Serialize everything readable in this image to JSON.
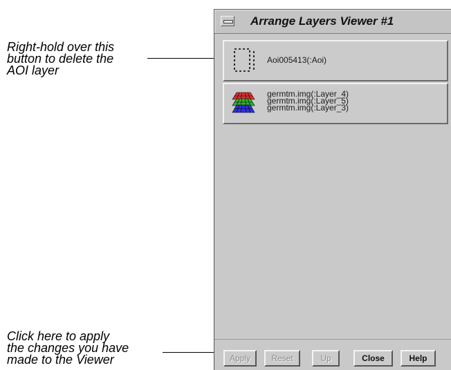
{
  "annotations": {
    "top": [
      "Right-hold over this",
      "button to delete the",
      "AOI layer"
    ],
    "bottom": [
      "Click here to apply",
      "the changes you have",
      "made to the Viewer"
    ]
  },
  "window": {
    "title": "Arrange Layers Viewer #1",
    "menu_icon": "window-menu-icon"
  },
  "layers": {
    "aoi": {
      "icon": "aoi-dashed-box-icon",
      "label": "Aoi005413(:Aoi)"
    },
    "image": {
      "icon": "layer-stack-icon",
      "lines": [
        "germtm.img(:Layer_4)",
        "germtm.img(:Layer_5)",
        "germtm.img(:Layer_3)"
      ],
      "colors": [
        "#e03030",
        "#30b030",
        "#3030e0"
      ]
    }
  },
  "buttons": {
    "apply": "Apply",
    "reset": "Reset",
    "up": "Up",
    "close": "Close",
    "help": "Help"
  }
}
